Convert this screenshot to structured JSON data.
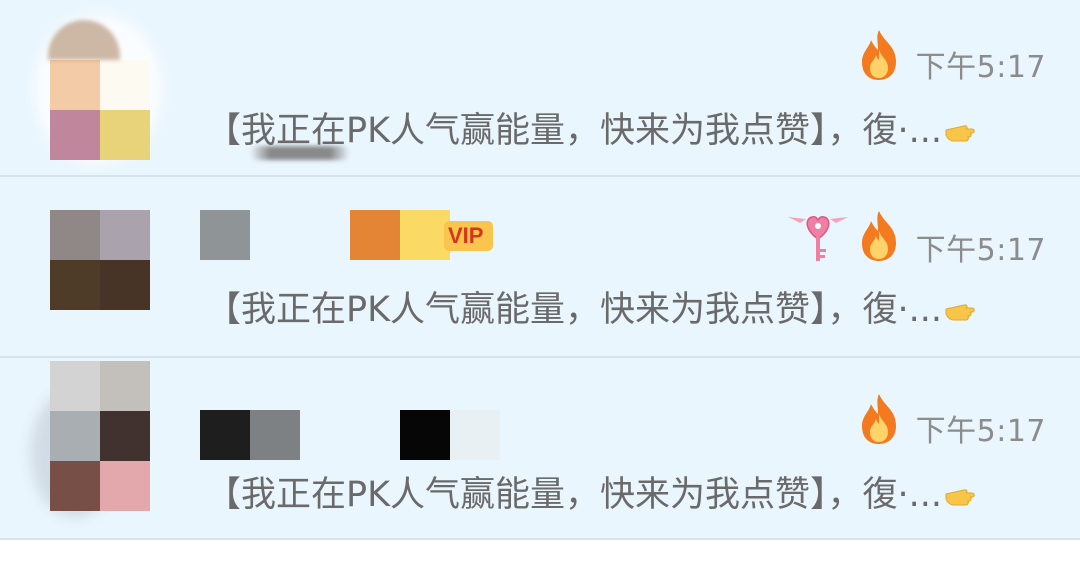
{
  "conversations": [
    {
      "time": "下午5:17",
      "message": "【我正在PK人气赢能量，快来为我点赞】，復·...",
      "has_vip": false,
      "has_key_badge": false,
      "avatar_pixels": [
        "#f3cba6",
        "#fdfaf2",
        "#c0879c",
        "#e8d27a"
      ],
      "name_pixels": []
    },
    {
      "time": "下午5:17",
      "message": "【我正在PK人气赢能量，快来为我点赞】，復·...",
      "has_vip": true,
      "vip_label": "VIP",
      "has_key_badge": true,
      "avatar_pixels": [
        "#8f8886",
        "#aaa2ac",
        "#4e3b28",
        "#483426"
      ],
      "name_pixels": [
        "#8f9596",
        "#eaf6fd",
        "#eaf6fd",
        "#e48535",
        "#fad964"
      ]
    },
    {
      "time": "下午5:17",
      "message": "【我正在PK人气赢能量，快来为我点赞】，復·...",
      "has_vip": false,
      "has_key_badge": false,
      "avatar_pixels": [
        "#d3d3d3",
        "#c3bfbb",
        "#a8aeb2",
        "#42322f",
        "#774f46",
        "#e2a8ab"
      ],
      "name_pixels": [
        "#1f1e1e",
        "#7d8183",
        "#eaf6fd",
        "#eaf6fd",
        "#060606",
        "#e8f0f4"
      ]
    }
  ],
  "colors": {
    "background": "#eaf6fd",
    "divider": "#d6e3ec",
    "text_gray": "#6a6a6a",
    "time_gray": "#8c8c8c",
    "vip_bg": "#f9c54e",
    "vip_text": "#d4361d",
    "fire": "#f37a1f"
  },
  "icons": {
    "fire": "fire-icon",
    "key": "heart-key-icon",
    "hand": "pointing-hand-icon"
  }
}
